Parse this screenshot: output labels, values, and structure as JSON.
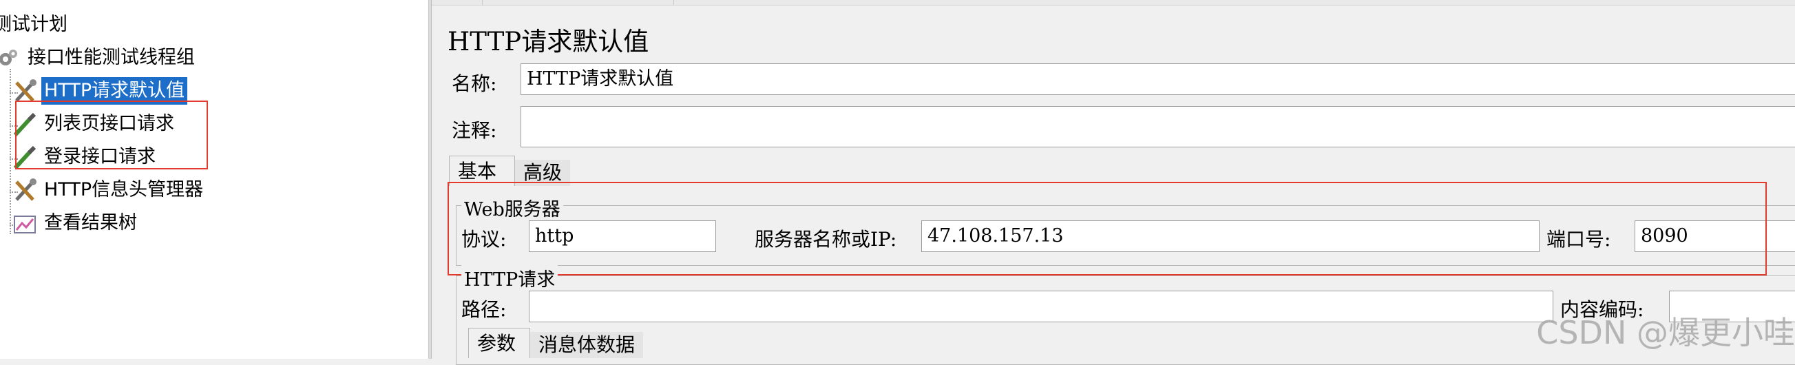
{
  "tree": {
    "items": [
      {
        "label": "测试计划"
      },
      {
        "label": "接口性能测试线程组"
      },
      {
        "label": "HTTP请求默认值"
      },
      {
        "label": "列表页接口请求"
      },
      {
        "label": "登录接口请求"
      },
      {
        "label": "HTTP信息头管理器"
      },
      {
        "label": "查看结果树"
      }
    ]
  },
  "editor": {
    "title": "HTTP请求默认值",
    "name_label": "名称:",
    "name_value": "HTTP请求默认值",
    "comment_label": "注释:",
    "comment_value": "",
    "tabs": [
      {
        "label": "基本",
        "active": true
      },
      {
        "label": "高级",
        "active": false
      }
    ],
    "web_server": {
      "title": "Web服务器",
      "protocol_label": "协议:",
      "protocol_value": "http",
      "server_label": "服务器名称或IP:",
      "server_value": "47.108.157.13",
      "port_label": "端口号:",
      "port_value": "8090"
    },
    "http_request": {
      "title": "HTTP请求",
      "path_label": "路径:",
      "path_value": "",
      "encoding_label": "内容编码:",
      "encoding_value": "",
      "subtabs": [
        {
          "label": "参数",
          "active": true
        },
        {
          "label": "消息体数据",
          "active": false
        }
      ]
    }
  },
  "watermark": "CSDN @爆更小哇",
  "colors": {
    "selection": "#1c6ec9",
    "annotation_red": "#e53b2f"
  }
}
